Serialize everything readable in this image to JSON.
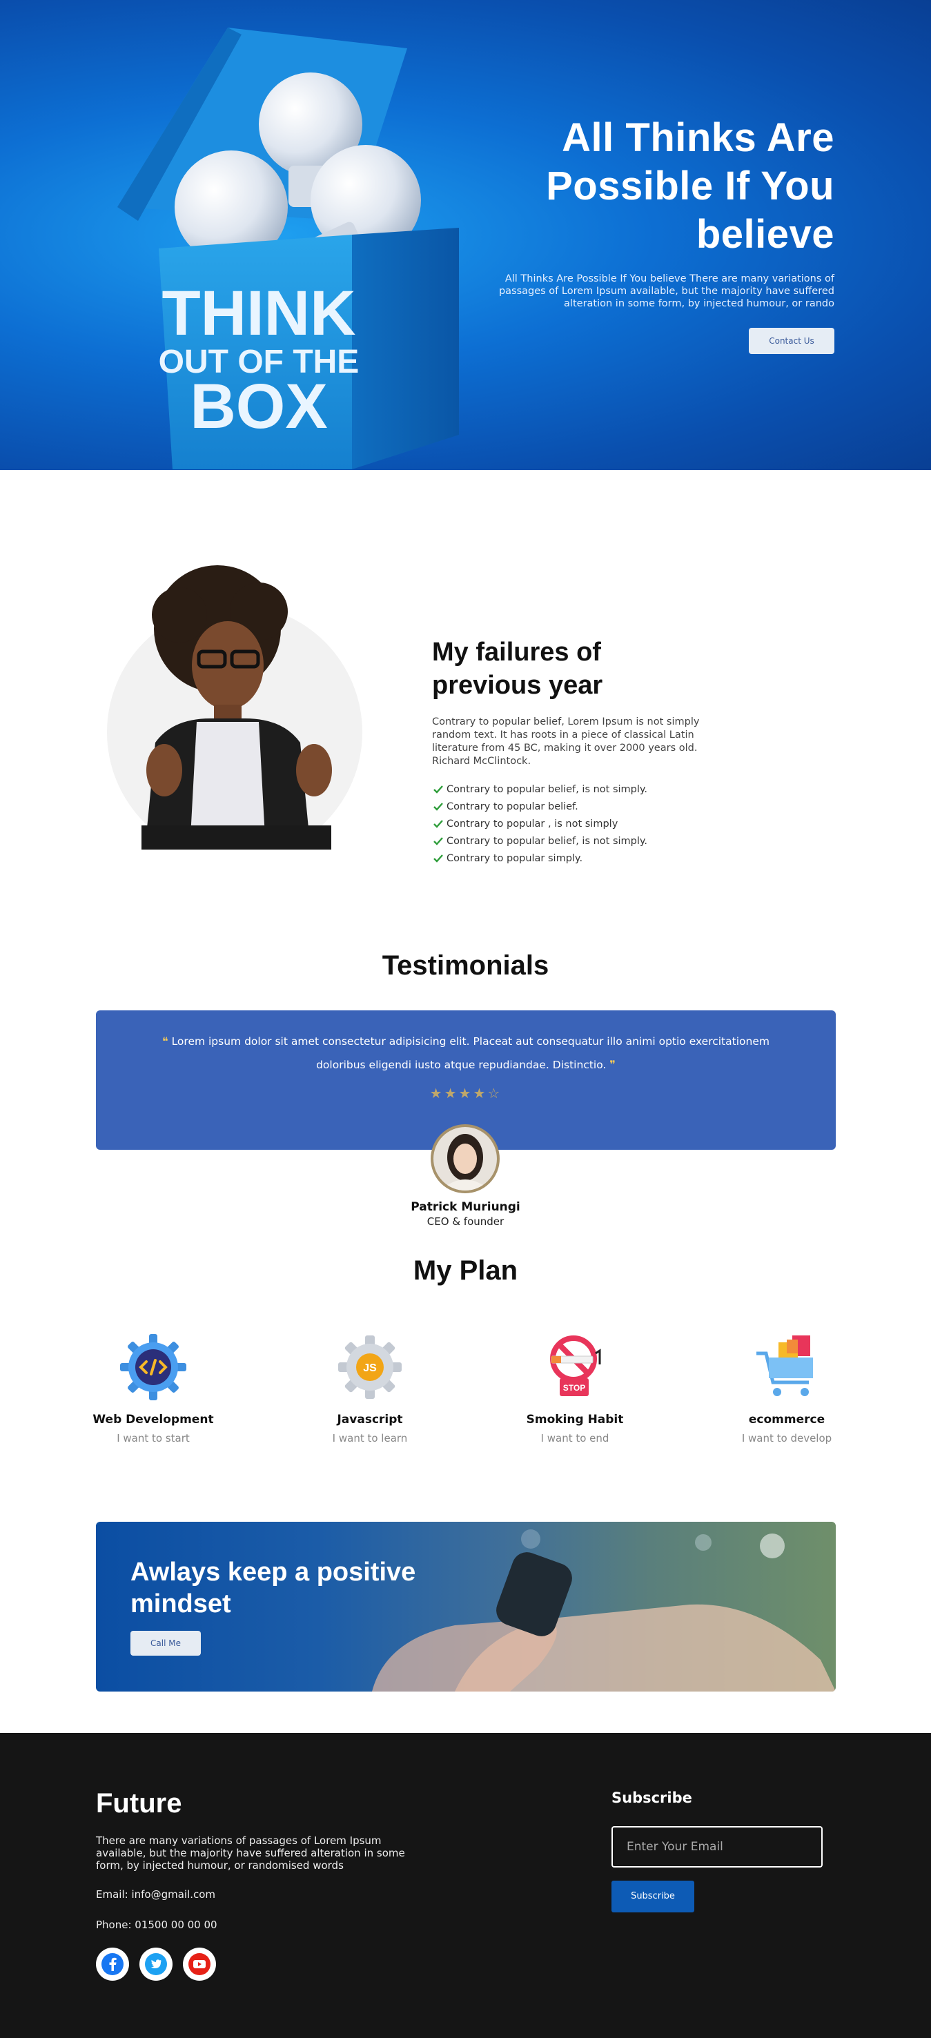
{
  "hero": {
    "title_line1": "All Thinks Are",
    "title_line2": "Possible If You",
    "title_line3": "believe",
    "subtitle": "All Thinks Are Possible If You believe There are many variations of passages of Lorem Ipsum available, but the majority have suffered alteration in some form, by injected humour, or rando",
    "button_label": "Contact Us",
    "box_text_line1": "THINK",
    "box_text_line2": "OUT OF THE",
    "box_text_line3": "BOX"
  },
  "failures": {
    "title_line1": "My failures of",
    "title_line2": "previous year",
    "body": "Contrary to popular belief, Lorem Ipsum is not simply random text. It has roots in a piece of classical Latin literature from 45 BC, making it over 2000 years old. Richard McClintock.",
    "items": [
      "Contrary to popular belief, is not simply.",
      "Contrary to popular belief.",
      "Contrary to popular , is not simply",
      "Contrary to popular belief, is not simply.",
      "Contrary to popular simply."
    ]
  },
  "testimonials": {
    "title": "Testimonials",
    "quote": "Lorem ipsum dolor sit amet consectetur adipisicing elit. Placeat aut consequatur illo animi optio exercitationem doloribus eligendi iusto atque repudiandae. Distinctio.",
    "rating": 4.5,
    "stars": "★★★★☆",
    "name": "Patrick Muriungi",
    "role": "CEO & founder"
  },
  "plan": {
    "title": "My Plan",
    "items": [
      {
        "name": "Web Development",
        "desc": "I want to start",
        "icon": "code-gear-icon"
      },
      {
        "name": "Javascript",
        "desc": "I want to learn",
        "icon": "js-gear-icon"
      },
      {
        "name": "Smoking Habit",
        "desc": "I want to end",
        "icon": "no-smoking-icon"
      },
      {
        "name": "ecommerce",
        "desc": "I want to develop",
        "icon": "shopping-cart-icon"
      }
    ]
  },
  "banner": {
    "title_line1": "Awlays keep a positive",
    "title_line2": "mindset",
    "button_label": "Call Me"
  },
  "footer": {
    "title": "Future",
    "description": "There are many variations of passages of Lorem Ipsum available, but the majority have suffered alteration in some form, by injected humour, or randomised words",
    "email": "Email: info@gmail.com",
    "phone": "Phone: 01500 00 00 00",
    "subscribe_title": "Subscribe",
    "email_placeholder": "Enter Your Email",
    "subscribe_button": "Subscribe"
  },
  "colors": {
    "hero_blue": "#0d6fd3",
    "testimonial_card": "#3a63b8",
    "footer_bg": "#151515",
    "subscribe_button": "#0d5bb5"
  }
}
